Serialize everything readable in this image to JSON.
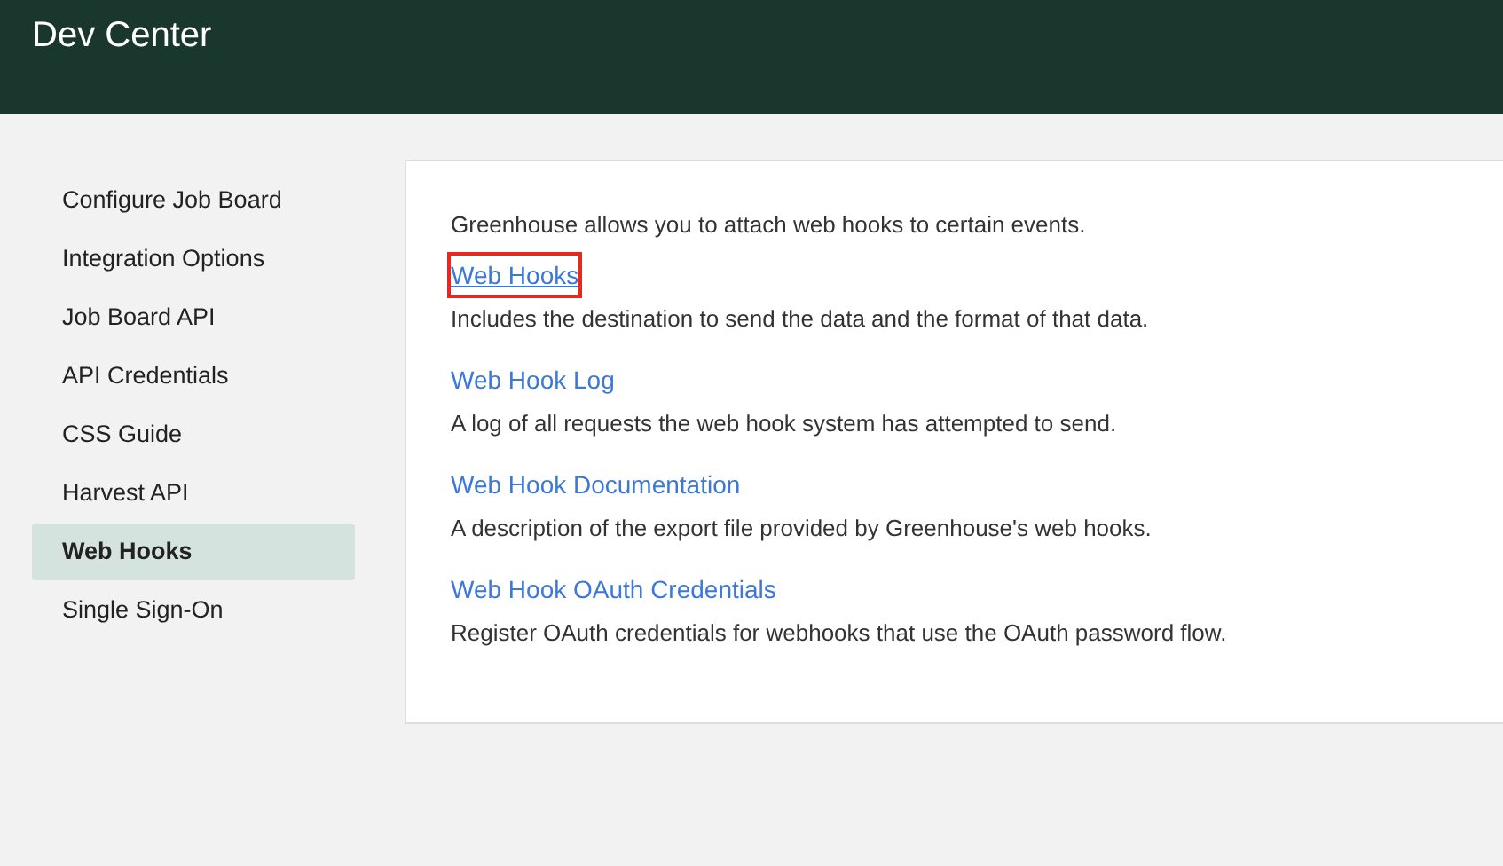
{
  "header": {
    "title": "Dev Center"
  },
  "sidebar": {
    "items": [
      {
        "label": "Configure Job Board",
        "selected": false
      },
      {
        "label": "Integration Options",
        "selected": false
      },
      {
        "label": "Job Board API",
        "selected": false
      },
      {
        "label": "API Credentials",
        "selected": false
      },
      {
        "label": "CSS Guide",
        "selected": false
      },
      {
        "label": "Harvest API",
        "selected": false
      },
      {
        "label": "Web Hooks",
        "selected": true
      },
      {
        "label": "Single Sign-On",
        "selected": false
      }
    ]
  },
  "content": {
    "intro": "Greenhouse allows you to attach web hooks to certain events.",
    "links": [
      {
        "label": "Web Hooks",
        "description": "Includes the destination to send the data and the format of that data.",
        "highlighted": true
      },
      {
        "label": "Web Hook Log",
        "description": "A log of all requests the web hook system has attempted to send.",
        "highlighted": false
      },
      {
        "label": "Web Hook Documentation",
        "description": "A description of the export file provided by Greenhouse's web hooks.",
        "highlighted": false
      },
      {
        "label": "Web Hook OAuth Credentials",
        "description": "Register OAuth credentials for webhooks that use the OAuth password flow.",
        "highlighted": false
      }
    ]
  }
}
